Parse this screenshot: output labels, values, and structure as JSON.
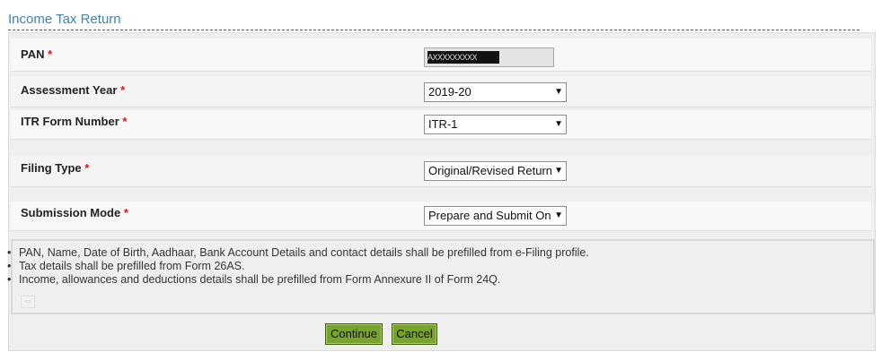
{
  "page": {
    "title": "Income Tax Return",
    "required_marker": "*"
  },
  "form": {
    "pan": {
      "label": "PAN",
      "value": "AXXXXXXXXX"
    },
    "assessment_year": {
      "label": "Assessment Year",
      "selected": "2019-20"
    },
    "itr_form_number": {
      "label": "ITR Form Number",
      "selected": "ITR-1"
    },
    "filing_type": {
      "label": "Filing Type",
      "selected": "Original/Revised Return"
    },
    "submission_mode": {
      "label": "Submission Mode",
      "selected": "Prepare and Submit Online"
    }
  },
  "info": {
    "notes": [
      "PAN, Name, Date of Birth, Aadhaar, Bank Account Details and contact details shall be prefilled from e-Filing profile.",
      "Tax details shall be prefilled from Form 26AS.",
      "Income, allowances and deductions details shall be prefilled from Form Annexure II of Form 24Q."
    ]
  },
  "buttons": {
    "continue": "Continue",
    "cancel": "Cancel"
  },
  "icons": {
    "dropdown": "dropdown-arrow-icon",
    "info_small": "image-placeholder-icon"
  },
  "colors": {
    "title": "#3f83b3",
    "required": "#e0141a",
    "button": "#78a32c"
  }
}
